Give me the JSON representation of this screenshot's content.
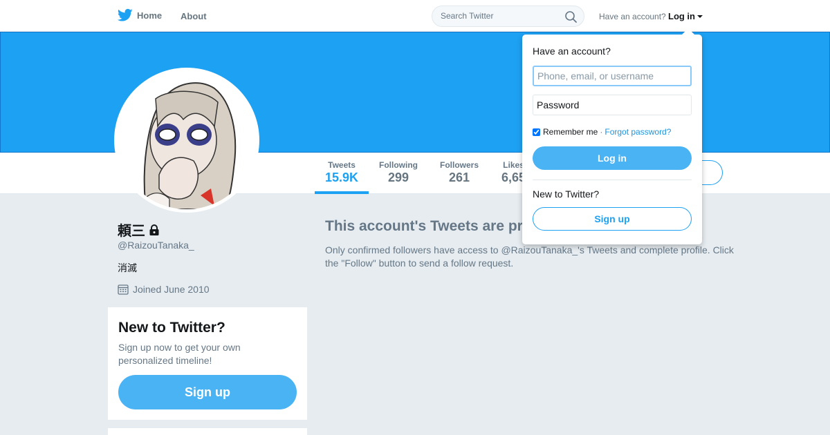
{
  "nav": {
    "home_label": "Home",
    "about_label": "About",
    "search_placeholder": "Search Twitter",
    "have_account_text": "Have an account?",
    "login_label": "Log in"
  },
  "profile": {
    "name": "頼三",
    "handle": "@RaizouTanaka_",
    "bio": "消滅",
    "joined": "Joined June 2010",
    "protected": true
  },
  "stats": [
    {
      "label": "Tweets",
      "value": "15.9K",
      "active": true
    },
    {
      "label": "Following",
      "value": "299",
      "active": false
    },
    {
      "label": "Followers",
      "value": "261",
      "active": false
    },
    {
      "label": "Likes",
      "value": "6,65",
      "active": false
    }
  ],
  "protected_notice": {
    "title": "This account's Tweets are pr",
    "desc": "Only confirmed followers have access to @RaizouTanaka_'s Tweets and complete profile. Click the \"Follow\" button to send a follow request."
  },
  "new_to_twitter_card": {
    "title": "New to Twitter?",
    "desc": "Sign up now to get your own personalized timeline!",
    "signup_label": "Sign up"
  },
  "login_dropdown": {
    "title": "Have an account?",
    "username_placeholder": "Phone, email, or username",
    "password_placeholder": "Password",
    "remember_label": "Remember me",
    "separator": "·",
    "forgot_label": "Forgot password?",
    "remember_checked": true,
    "login_label": "Log in",
    "new_prompt": "New to Twitter?",
    "signup_label": "Sign up"
  },
  "colors": {
    "brand": "#1da1f2",
    "button": "#4ab3f4",
    "background": "#e6ecf0"
  }
}
